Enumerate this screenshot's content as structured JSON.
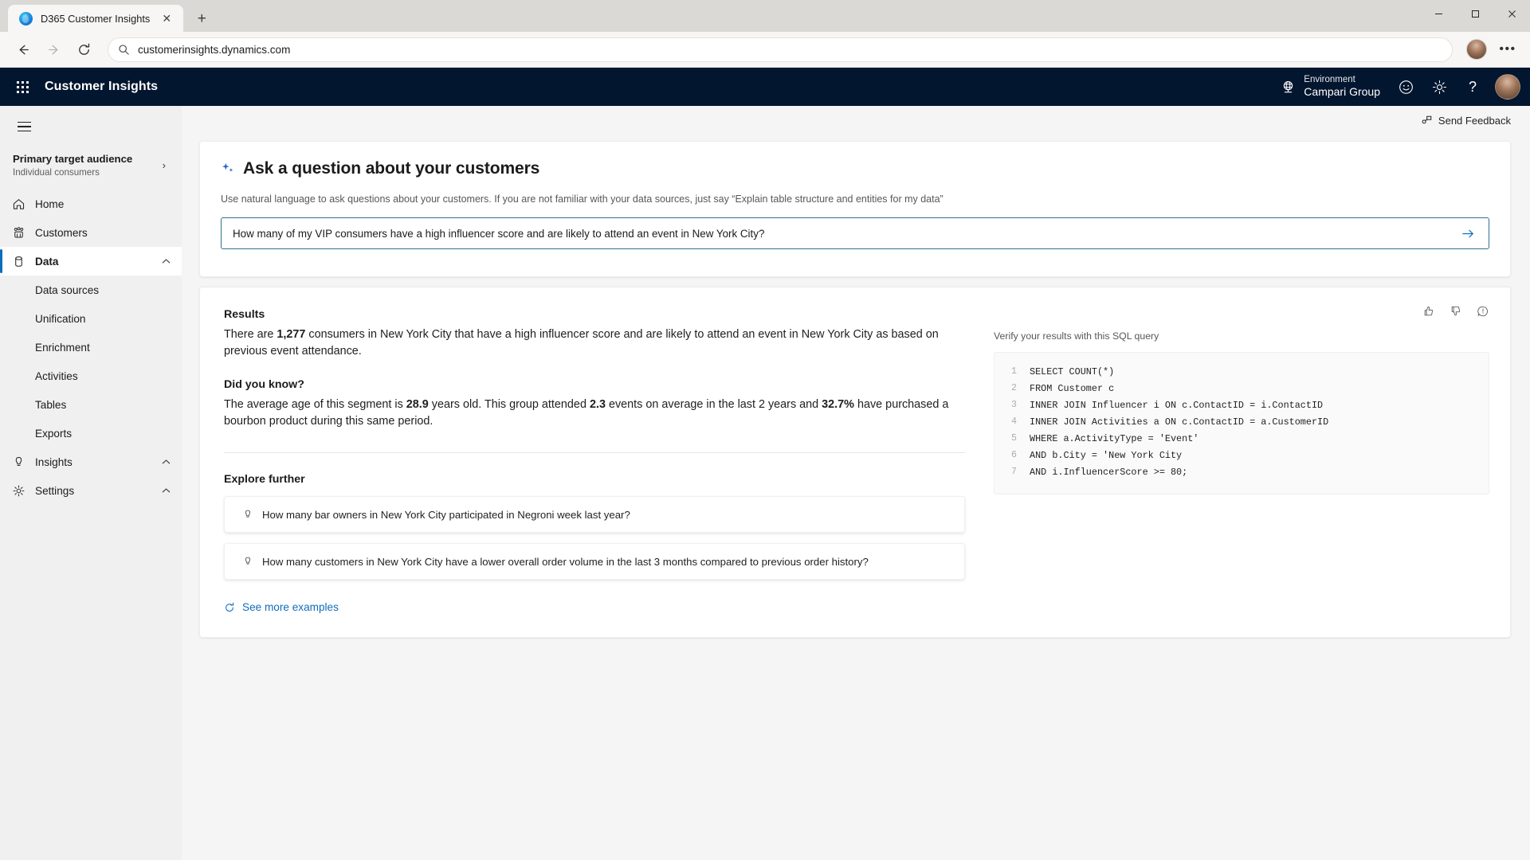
{
  "browser": {
    "tab": {
      "title": "D365 Customer Insights",
      "favicon": "d365-favicon",
      "close": "✕"
    },
    "new_tab": "+",
    "window_controls": {
      "minimize": "─",
      "maximize": "□",
      "close": "✕"
    },
    "toolbar": {
      "back": "back-icon",
      "forward": "forward-icon",
      "reload": "reload-icon",
      "url": "customerinsights.dynamics.com",
      "search_icon": "search-icon",
      "profile": "browser-profile-avatar",
      "menu": "•••"
    }
  },
  "app_header": {
    "waffle": "app-launcher-icon",
    "title": "Customer Insights",
    "environment": {
      "label": "Environment",
      "value": "Campari Group",
      "icon": "environment-globe-icon"
    },
    "icons": {
      "feedback": "smiley-icon",
      "settings": "gear-icon",
      "help": "?"
    },
    "avatar": "user-avatar"
  },
  "sidebar": {
    "hamburger": "hamburger-menu-icon",
    "audience": {
      "title": "Primary target audience",
      "subtitle": "Individual consumers",
      "chevron": "›"
    },
    "items": [
      {
        "label": "Home",
        "icon": "home-icon",
        "type": "item"
      },
      {
        "label": "Customers",
        "icon": "customers-icon",
        "type": "item"
      },
      {
        "label": "Data",
        "icon": "database-icon",
        "type": "item",
        "selected": true,
        "expanded": true,
        "chevron": "⌃"
      },
      {
        "label": "Data sources",
        "type": "sub"
      },
      {
        "label": "Unification",
        "type": "sub"
      },
      {
        "label": "Enrichment",
        "type": "sub"
      },
      {
        "label": "Activities",
        "type": "sub"
      },
      {
        "label": "Tables",
        "type": "sub"
      },
      {
        "label": "Exports",
        "type": "sub"
      },
      {
        "label": "Insights",
        "icon": "lightbulb-icon",
        "type": "item",
        "chevron": "⌃"
      },
      {
        "label": "Settings",
        "icon": "gear-icon",
        "type": "item",
        "chevron": "⌃"
      }
    ]
  },
  "main": {
    "send_feedback": {
      "label": "Send Feedback",
      "icon": "send-feedback-icon"
    },
    "ask": {
      "sparkle_icon": "sparkle-icon",
      "title": "Ask a question about your customers",
      "subtitle": "Use natural language to ask questions about your customers. If you are not familiar with your data sources, just say “Explain table structure and entities for my data”",
      "input_value": "How many of my VIP consumers have a high influencer score and are likely to attend an event in New York City?",
      "input_placeholder": "Ask a question about your customers",
      "submit_icon": "submit-arrow-icon"
    },
    "results": {
      "feedback": {
        "thumbs_up": "thumbs-up-icon",
        "thumbs_down": "thumbs-down-icon",
        "report": "report-issue-icon"
      },
      "heading": "Results",
      "answer_pre": "There are ",
      "answer_value": "1,277",
      "answer_post": " consumers in New York City that have a high influencer score and are likely to attend an event in New York City as based on previous event attendance.",
      "did_you_know_heading": "Did you know?",
      "dyk_p1": "The average age of this segment is ",
      "dyk_v1": "28.9",
      "dyk_p2": " years old. This group attended ",
      "dyk_v2": "2.3",
      "dyk_p3": " events on average in the last 2 years and ",
      "dyk_v3": "32.7%",
      "dyk_p4": " have purchased a bourbon product during this same period.",
      "explore_heading": "Explore further",
      "suggestions": [
        {
          "icon": "lightbulb-icon",
          "text": "How many bar owners in New York City participated in Negroni week last year?"
        },
        {
          "icon": "lightbulb-icon",
          "text": "How many customers in New York City have a lower overall order volume in the last 3 months compared to previous order history?"
        }
      ],
      "see_more": {
        "label": "See more examples",
        "icon": "refresh-icon"
      },
      "sql_label": "Verify your results with this SQL query",
      "sql_lines": [
        {
          "n": "1",
          "code": "SELECT COUNT(*)"
        },
        {
          "n": "2",
          "code": "FROM Customer c"
        },
        {
          "n": "3",
          "code": "INNER JOIN Influencer i ON c.ContactID = i.ContactID"
        },
        {
          "n": "4",
          "code": "INNER JOIN Activities a ON c.ContactID = a.CustomerID"
        },
        {
          "n": "5",
          "code": "WHERE a.ActivityType = 'Event'"
        },
        {
          "n": "6",
          "code": "AND b.City = 'New York City"
        },
        {
          "n": "7",
          "code": "AND i.InfluencerScore >= 80;"
        }
      ]
    }
  },
  "colors": {
    "header_bg": "#031630",
    "accent": "#0f6cbd",
    "sidebar_bg": "#f0f0f0",
    "canvas_bg": "#f5f5f5",
    "input_border": "#31708e"
  }
}
